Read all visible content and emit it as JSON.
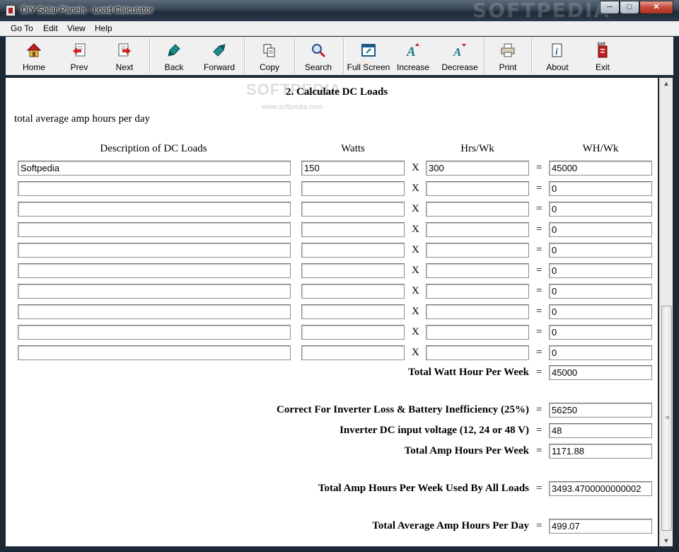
{
  "window": {
    "title": "DIY Solar Panels - Load Calculator",
    "watermark": "SOFTPEDIA"
  },
  "menu": [
    "Go To",
    "Edit",
    "View",
    "Help"
  ],
  "toolbar": {
    "home": "Home",
    "prev": "Prev",
    "next": "Next",
    "back": "Back",
    "forward": "Forward",
    "copy": "Copy",
    "search": "Search",
    "fullscreen": "Full Screen",
    "increase": "Increase",
    "decrease": "Decrease",
    "print": "Print",
    "about": "About",
    "exit": "Exit",
    "exit_icon_text": "EXIT"
  },
  "content": {
    "watermark": "SOFTPEDIA",
    "watermark_url": "www.softpedia.com",
    "heading": "2. Calculate DC Loads",
    "intro": "total average amp hours per day",
    "columns": {
      "desc": "Description of DC Loads",
      "watts": "Watts",
      "hrs": "Hrs/Wk",
      "wh": "WH/Wk"
    },
    "multiply_symbol": "X",
    "equals_symbol": "=",
    "rows": [
      {
        "desc": "Softpedia",
        "watts": "150",
        "hrs": "300",
        "wh": "45000"
      },
      {
        "desc": "",
        "watts": "",
        "hrs": "",
        "wh": "0"
      },
      {
        "desc": "",
        "watts": "",
        "hrs": "",
        "wh": "0"
      },
      {
        "desc": "",
        "watts": "",
        "hrs": "",
        "wh": "0"
      },
      {
        "desc": "",
        "watts": "",
        "hrs": "",
        "wh": "0"
      },
      {
        "desc": "",
        "watts": "",
        "hrs": "",
        "wh": "0"
      },
      {
        "desc": "",
        "watts": "",
        "hrs": "",
        "wh": "0"
      },
      {
        "desc": "",
        "watts": "",
        "hrs": "",
        "wh": "0"
      },
      {
        "desc": "",
        "watts": "",
        "hrs": "",
        "wh": "0"
      },
      {
        "desc": "",
        "watts": "",
        "hrs": "",
        "wh": "0"
      }
    ],
    "summary": [
      {
        "label": "Total Watt Hour Per Week",
        "value": "45000"
      },
      {
        "label": "Correct For Inverter Loss & Battery Inefficiency (25%)",
        "value": "56250"
      },
      {
        "label": "Inverter DC input voltage (12, 24 or 48 V)",
        "value": "48"
      },
      {
        "label": "Total Amp Hours Per Week",
        "value": "1171.88"
      },
      {
        "label": "Total Amp Hours Per Week Used By All Loads",
        "value": "3493.4700000000002"
      },
      {
        "label": "Total Average Amp Hours Per Day",
        "value": "499.07"
      }
    ]
  }
}
